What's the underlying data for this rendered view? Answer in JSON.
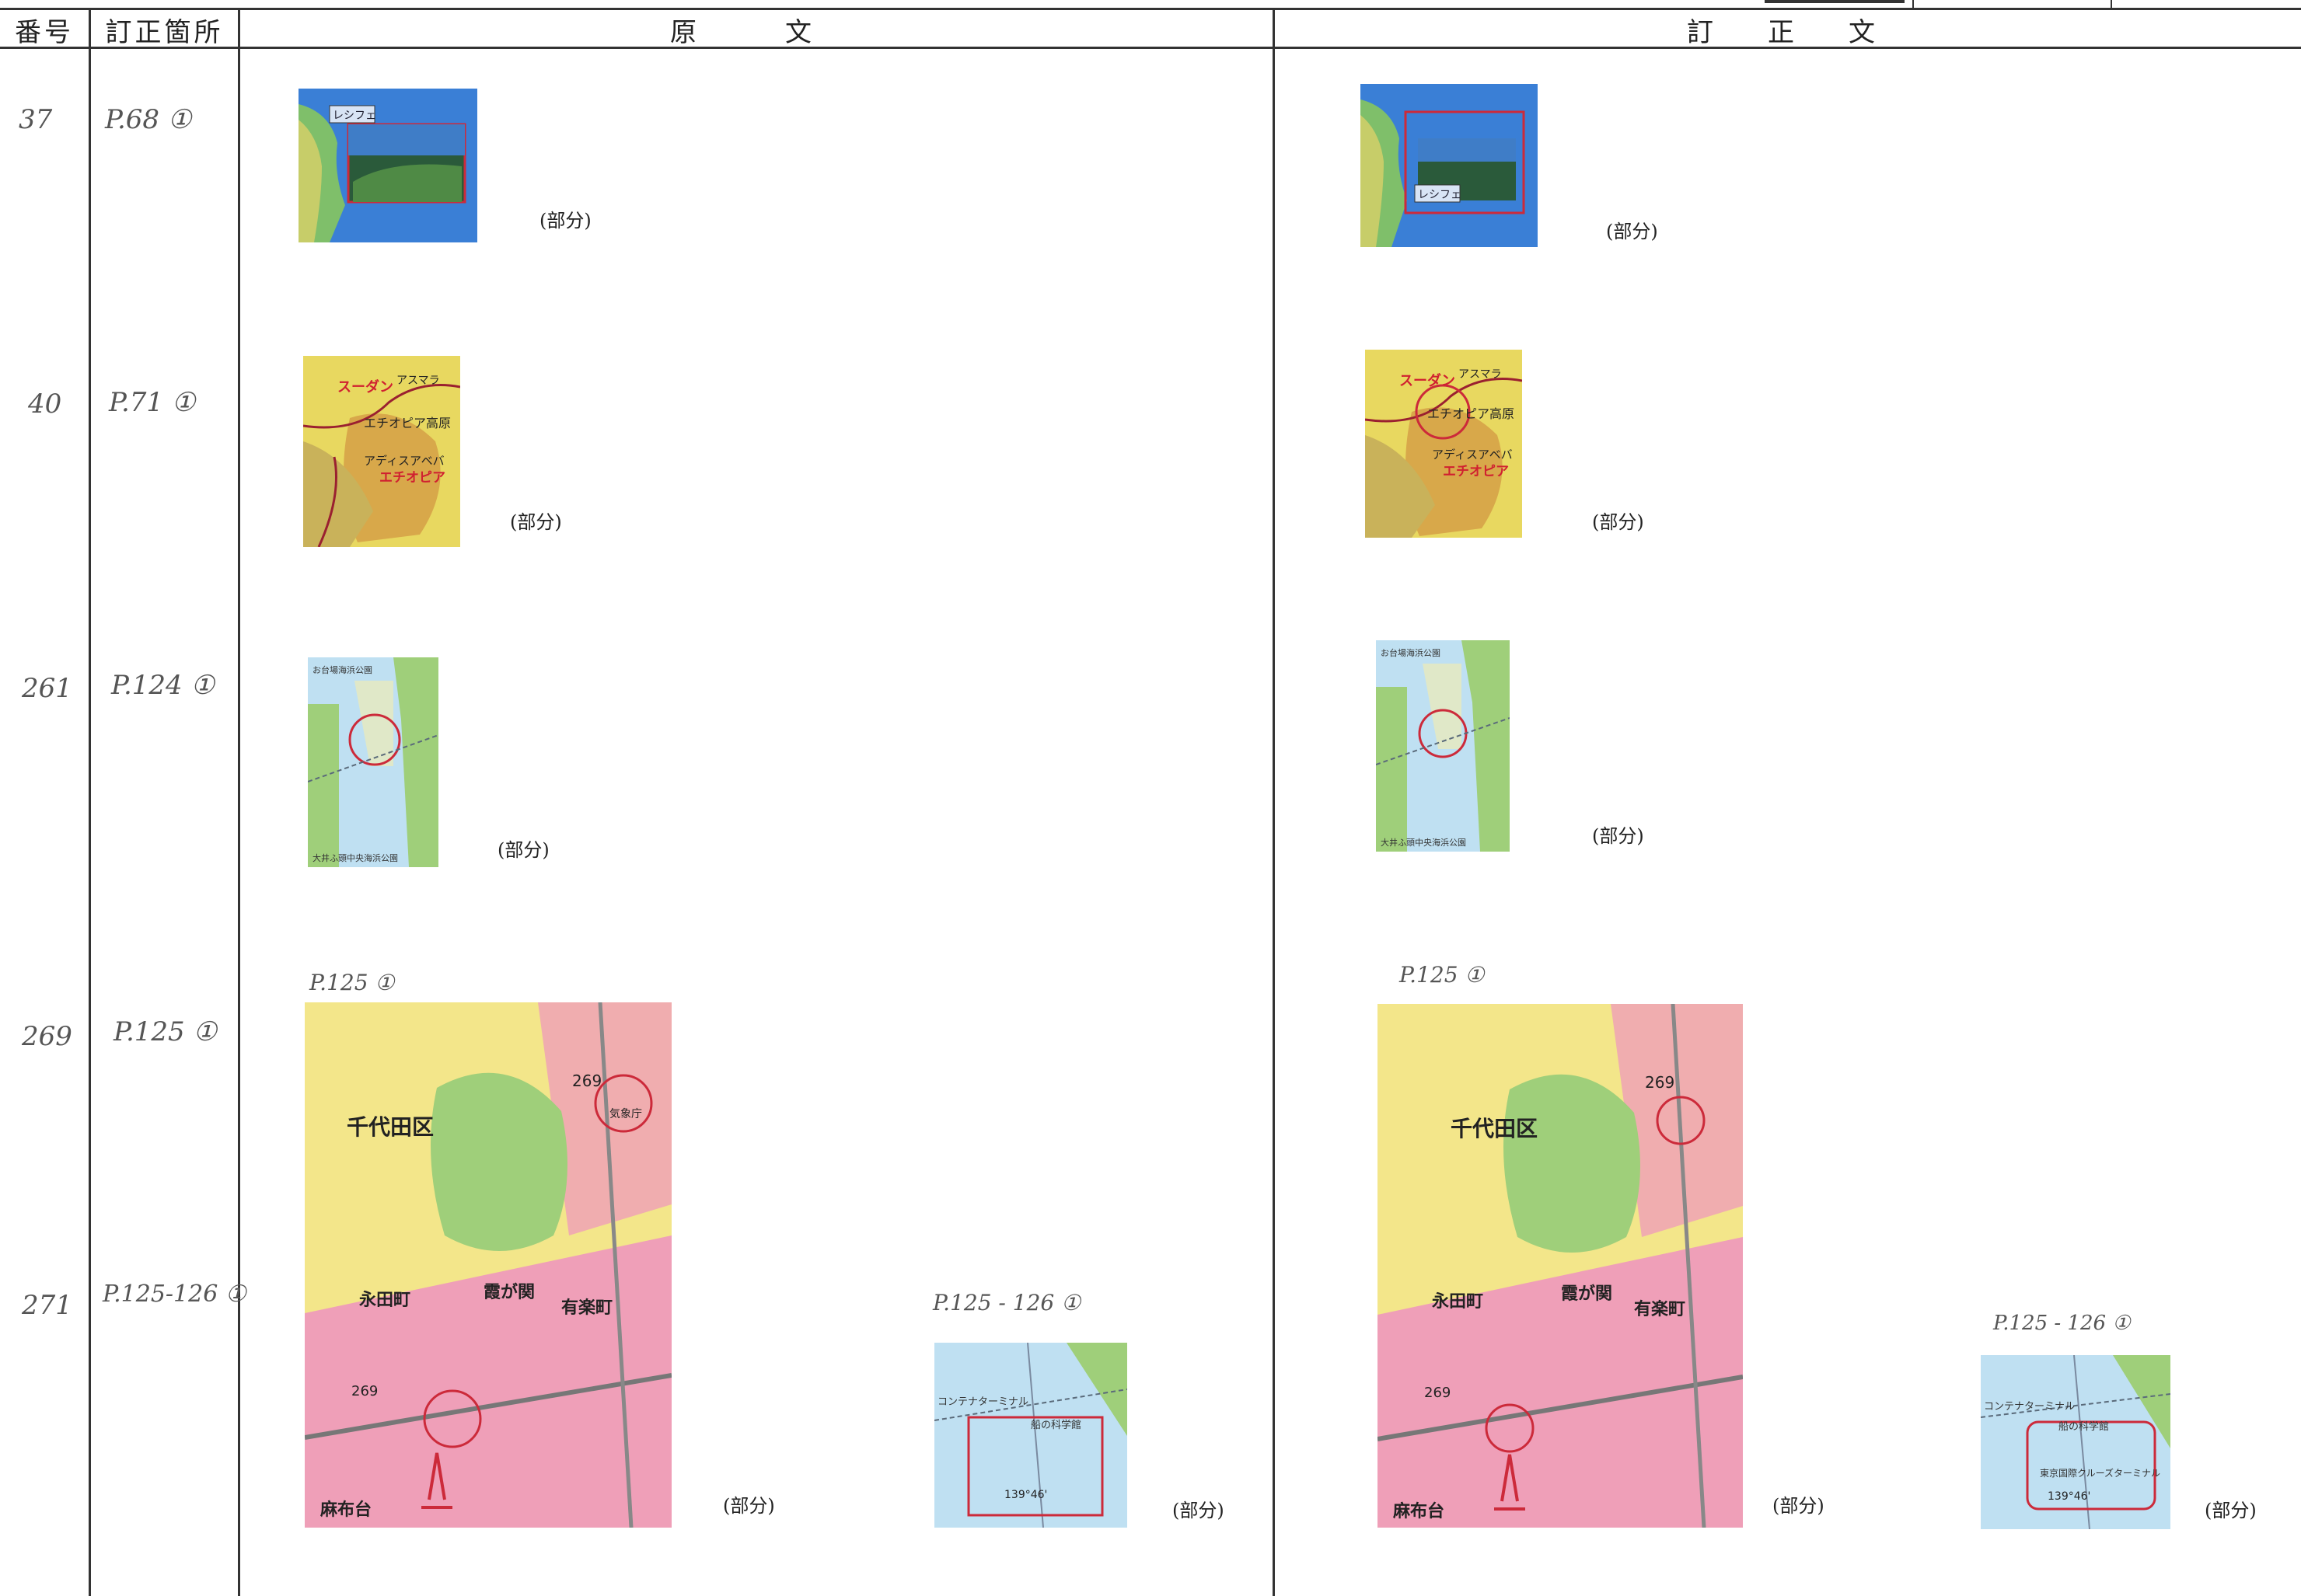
{
  "header": {
    "col_number": "番号",
    "col_location": "訂正箇所",
    "col_original": "原　文",
    "col_corrected": "訂　正　文"
  },
  "rows": [
    {
      "number": "37",
      "location": "P.68 ①"
    },
    {
      "number": "40",
      "location": "P.71 ①"
    },
    {
      "number": "261",
      "location": "P.124 ①"
    },
    {
      "number": "269",
      "location": "P.125 ①"
    },
    {
      "number": "271",
      "location": "P.125-126 ①"
    }
  ],
  "partial_label": "(部分)",
  "page_notes": {
    "orig_p125": "P.125 ①",
    "orig_p125_126": "P.125 - 126 ①",
    "corr_p125": "P.125 ①",
    "corr_p125_126": "P.125 - 126 ①"
  },
  "maps": {
    "recife": "レシフェ",
    "sudan": "スーダン",
    "asmara": "アスマラ",
    "ethiopia_highland": "エチオピア高原",
    "addis": "アディスアベバ",
    "ethiopia": "エチオピア",
    "odaiba_park": "お台場海浜公園",
    "oi_park": "大井ふ頭中央海浜公園",
    "chiyoda": "千代田区",
    "circle_269": "269",
    "kishocho": "気象庁",
    "kasumigaseki": "霞が関",
    "nagatacho": "永田町",
    "yurakucho": "有楽町",
    "azabudai": "麻布台",
    "container": "コンテナターミナル",
    "ship_museum": "船の科学館",
    "coord": "139°46'",
    "cruise_terminal": "東京国際クルーズターミナル"
  },
  "colors": {
    "sea": "#3a7fd6",
    "land_yellow": "#e8d860",
    "urban_pink": "#ef9fb8",
    "park_green": "#9fcf7a",
    "water_light": "#bfe0f2",
    "red_mark": "#cc2a3a"
  }
}
